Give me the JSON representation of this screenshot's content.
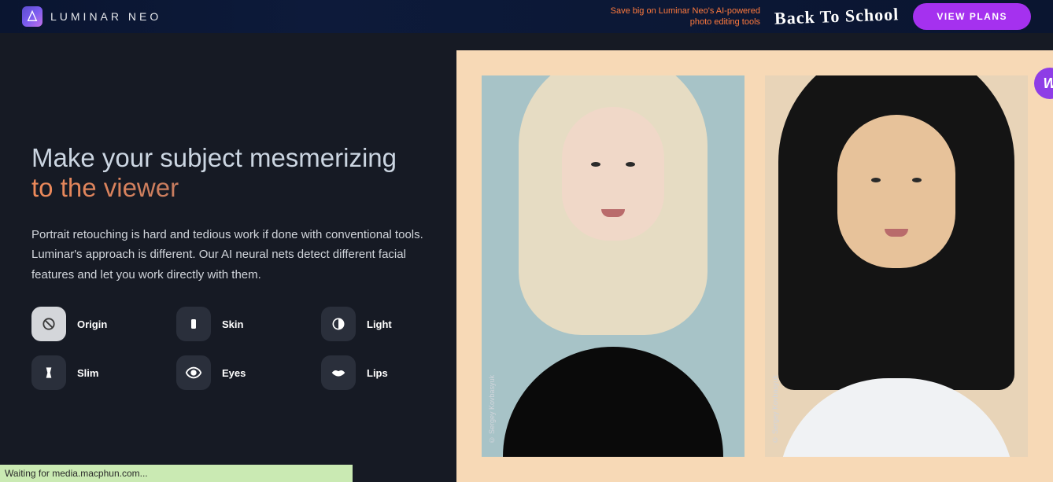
{
  "banner": {
    "brand_name": "LUMINAR NEO",
    "promo_line1": "Save big on Luminar Neo's AI-powered",
    "promo_line2": "photo editing tools",
    "promo_script": "Back To School",
    "cta_label": "VIEW PLANS"
  },
  "hero": {
    "headline_part1": "Make your subject mesmerizing ",
    "headline_accent": "to the viewer",
    "subtext": "Portrait retouching is hard and tedious work if done with conventional tools. Luminar's approach is different. Our AI neural nets detect different facial features and let you work directly with them."
  },
  "tools": [
    {
      "id": "origin",
      "label": "Origin",
      "icon": "ban-icon",
      "active": true
    },
    {
      "id": "skin",
      "label": "Skin",
      "icon": "skin-icon",
      "active": false
    },
    {
      "id": "light",
      "label": "Light",
      "icon": "contrast-icon",
      "active": false
    },
    {
      "id": "slim",
      "label": "Slim",
      "icon": "slim-icon",
      "active": false
    },
    {
      "id": "eyes",
      "label": "Eyes",
      "icon": "eye-icon",
      "active": false
    },
    {
      "id": "lips",
      "label": "Lips",
      "icon": "lips-icon",
      "active": false
    }
  ],
  "gallery": {
    "credit1": "© Sergey Kovbasyuk",
    "credit2": "© Sergey Kovbasyuk"
  },
  "status": {
    "text": "Waiting for media.macphun.com..."
  },
  "widget": {
    "glyph": "W"
  }
}
